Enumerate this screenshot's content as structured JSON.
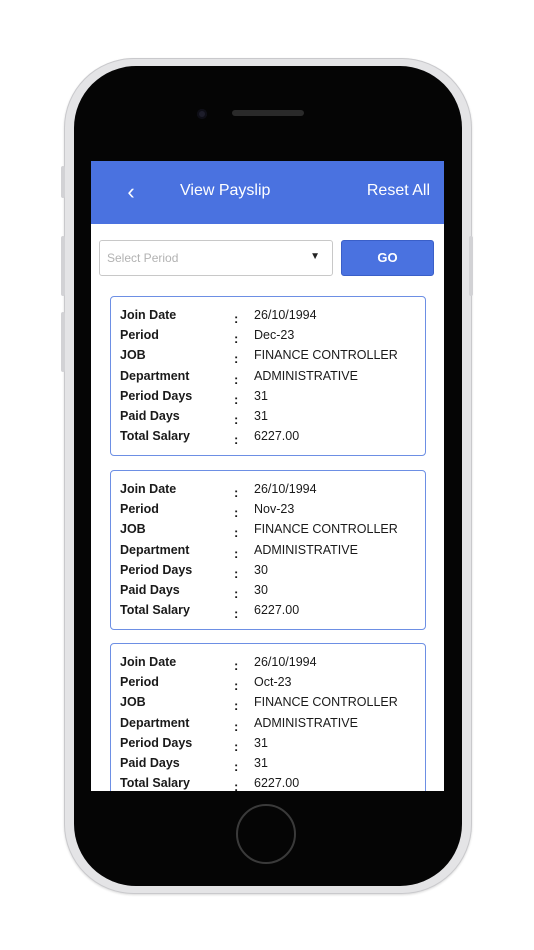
{
  "header": {
    "back_icon": "chevron-left-icon",
    "title": "View Payslip",
    "reset_label": "Reset All"
  },
  "filter": {
    "period_placeholder": "Select Period",
    "caret_icon": "dropdown-caret-icon",
    "caret_glyph": "▼",
    "go_label": "GO"
  },
  "labels": {
    "join_date": "Join Date",
    "period": "Period",
    "job": "JOB",
    "department": "Department",
    "period_days": "Period Days",
    "paid_days": "Paid Days",
    "total_salary": "Total Salary",
    "separator": ":"
  },
  "payslips": [
    {
      "join_date": "26/10/1994",
      "period": "Dec-23",
      "job": "FINANCE CONTROLLER",
      "department": "ADMINISTRATIVE",
      "period_days": "31",
      "paid_days": "31",
      "total_salary": "6227.00"
    },
    {
      "join_date": "26/10/1994",
      "period": "Nov-23",
      "job": "FINANCE CONTROLLER",
      "department": "ADMINISTRATIVE",
      "period_days": "30",
      "paid_days": "30",
      "total_salary": "6227.00"
    },
    {
      "join_date": "26/10/1994",
      "period": "Oct-23",
      "job": "FINANCE CONTROLLER",
      "department": "ADMINISTRATIVE",
      "period_days": "31",
      "paid_days": "31",
      "total_salary": "6227.00"
    }
  ]
}
